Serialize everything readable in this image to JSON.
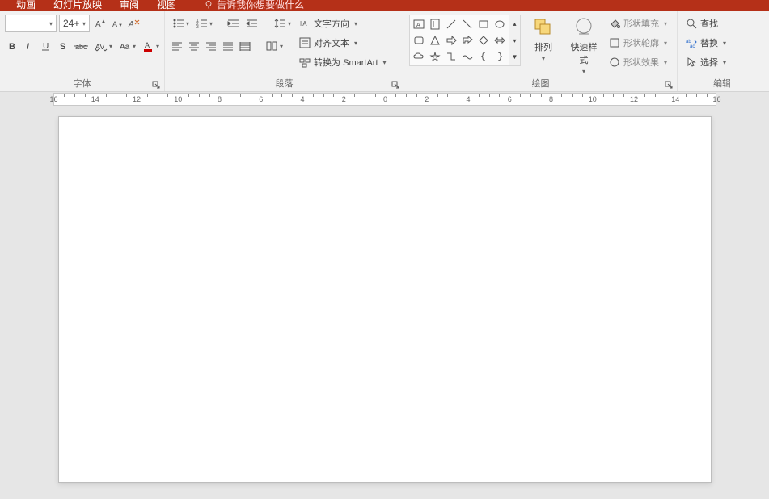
{
  "tabs": {
    "animation": "动画",
    "slideshow": "幻灯片放映",
    "review": "审阅",
    "view": "视图"
  },
  "tell_me": "告诉我你想要做什么",
  "font": {
    "size": "24+",
    "group_label": "字体"
  },
  "paragraph": {
    "group_label": "段落",
    "text_direction": "文字方向",
    "align_text": "对齐文本",
    "convert_smartart": "转换为 SmartArt"
  },
  "drawing": {
    "group_label": "绘图",
    "arrange": "排列",
    "quick_styles": "快速样式",
    "shape_fill": "形状填充",
    "shape_outline": "形状轮廓",
    "shape_effects": "形状效果"
  },
  "editing": {
    "group_label": "编辑",
    "find": "查找",
    "replace": "替换",
    "select": "选择"
  },
  "ruler_numbers": [
    "16",
    "14",
    "12",
    "10",
    "8",
    "6",
    "4",
    "2",
    "0",
    "2",
    "4",
    "6",
    "8",
    "10",
    "12",
    "14",
    "16"
  ]
}
